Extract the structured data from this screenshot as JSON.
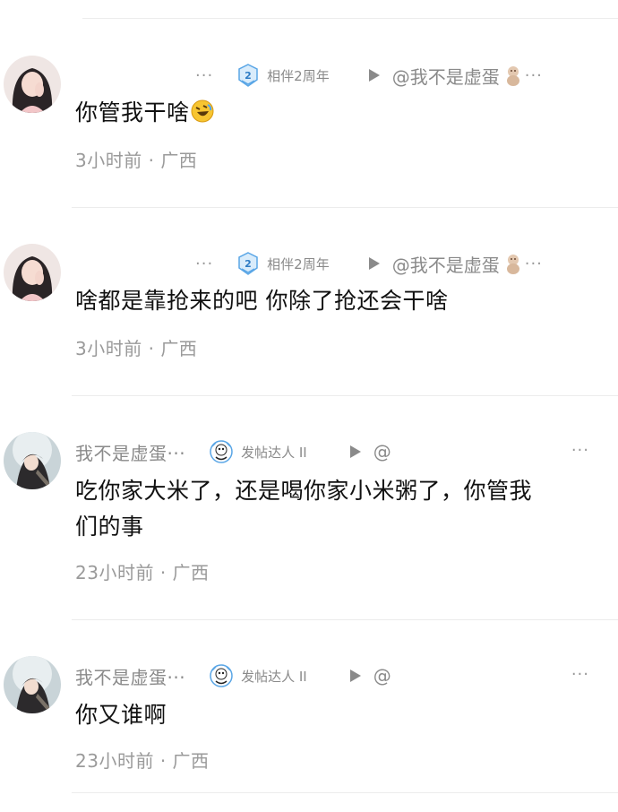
{
  "comments": [
    {
      "username": "",
      "username_ellipsis": "···",
      "badge": {
        "label": "相伴2周年",
        "icon": "anniversary-badge-icon",
        "number": "2"
      },
      "reply_to": "@我不是虚蛋",
      "reply_ellipsis": "···",
      "text": "你管我干啥",
      "emoji": "rofl-emoji-icon",
      "time": "3小时前",
      "separator": "·",
      "location": "广西"
    },
    {
      "username": "",
      "username_ellipsis": "···",
      "badge": {
        "label": "相伴2周年",
        "icon": "anniversary-badge-icon",
        "number": "2"
      },
      "reply_to": "@我不是虚蛋",
      "reply_ellipsis": "···",
      "text": "啥都是靠抢来的吧 你除了抢还会干啥",
      "time": "3小时前",
      "separator": "·",
      "location": "广西"
    },
    {
      "username": "我不是虚蛋···",
      "badge": {
        "label": "发帖达人 II",
        "icon": "poster-badge-icon"
      },
      "reply_to": "@",
      "more": "···",
      "text_line1": "吃你家大米了，还是喝你家小米粥了，你管我",
      "text_line2": "们的事",
      "time": "23小时前",
      "separator": "·",
      "location": "广西"
    },
    {
      "username": "我不是虚蛋···",
      "badge": {
        "label": "发帖达人 II",
        "icon": "poster-badge-icon"
      },
      "reply_to": "@",
      "more": "···",
      "text": "你又谁啊",
      "time": "23小时前",
      "separator": "·",
      "location": "广西"
    }
  ],
  "colors": {
    "meta_text": "#8a8a8a",
    "body_text": "#111111",
    "badge_blue": "#5aa6e6",
    "divider": "#ececec"
  }
}
